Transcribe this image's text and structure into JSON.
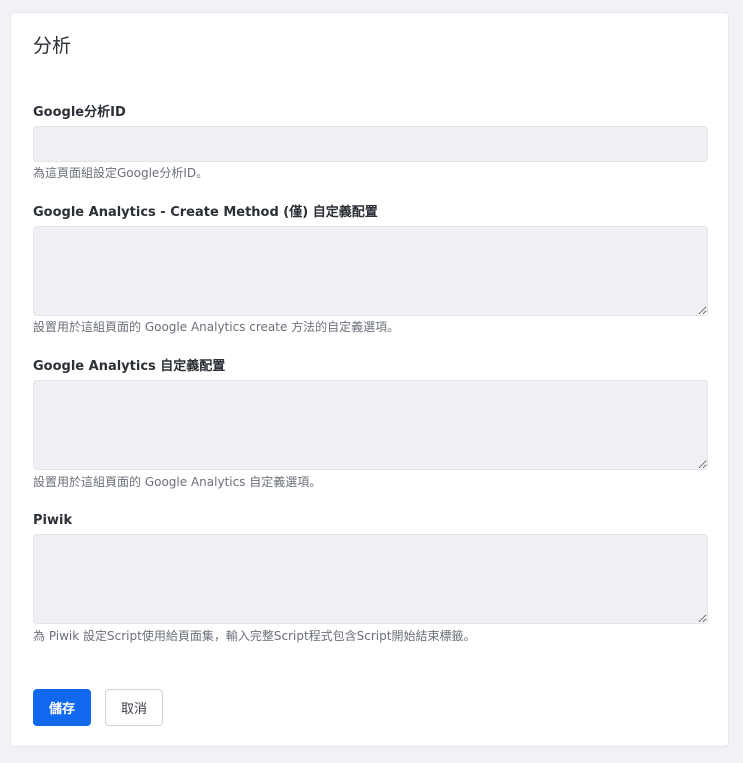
{
  "section": {
    "title": "分析"
  },
  "fields": {
    "ga_id": {
      "label": "Google分析ID",
      "value": "",
      "help": "為這頁面組設定Google分析ID。"
    },
    "ga_create": {
      "label": "Google Analytics - Create Method (僅) 自定義配置",
      "value": "",
      "help": "設置用於這組頁面的 Google Analytics create 方法的自定義選項。"
    },
    "ga_custom": {
      "label": "Google Analytics 自定義配置",
      "value": "",
      "help": "設置用於這組頁面的 Google Analytics 自定義選項。"
    },
    "piwik": {
      "label": "Piwik",
      "value": "",
      "help": "為 Piwik 設定Script使用給頁面集，輸入完整Script程式包含Script開始結束標籤。"
    }
  },
  "actions": {
    "save_label": "儲存",
    "cancel_label": "取消"
  },
  "colors": {
    "primary": "#1068ee",
    "input_bg": "#eff0f4",
    "page_bg": "#f1f2f5"
  }
}
